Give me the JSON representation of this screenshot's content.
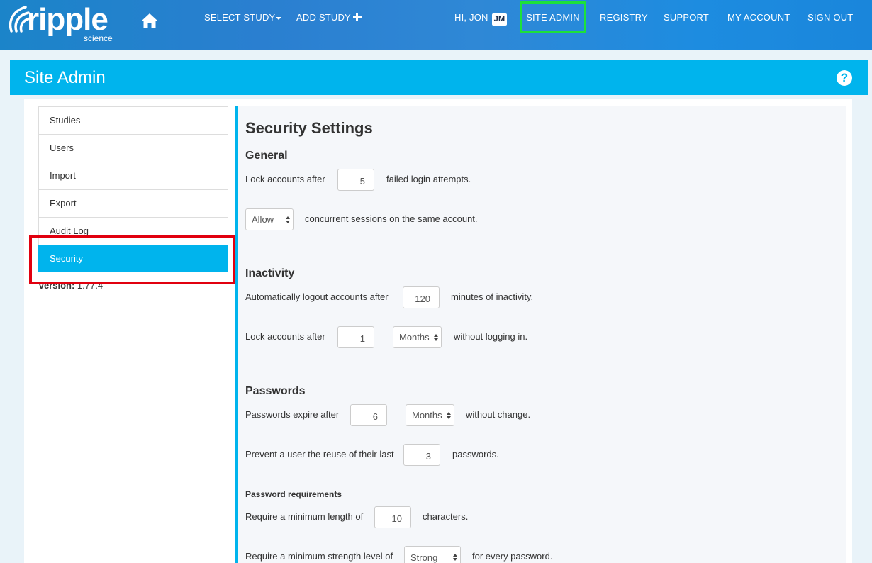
{
  "brand": {
    "logo_text": "ripple",
    "logo_sub": "science",
    "logo_icon": "ripple-waves-icon"
  },
  "nav": {
    "home_icon": "home-icon",
    "select_study": "SELECT STUDY",
    "add_study": "ADD STUDY",
    "greeting": "HI, JON",
    "user_initials": "JM",
    "site_admin": "SITE ADMIN",
    "registry": "REGISTRY",
    "support": "SUPPORT",
    "my_account": "MY ACCOUNT",
    "sign_out": "SIGN OUT"
  },
  "header": {
    "title": "Site Admin",
    "help_icon": "question-circle-icon",
    "help_glyph": "?"
  },
  "sidebar": {
    "items": [
      {
        "label": "Studies"
      },
      {
        "label": "Users"
      },
      {
        "label": "Import"
      },
      {
        "label": "Export"
      },
      {
        "label": "Audit Log"
      },
      {
        "label": "Security",
        "active": true
      }
    ],
    "version_label": "Version:",
    "version_value": "1.77.4"
  },
  "settings": {
    "title": "Security Settings",
    "general": {
      "title": "General",
      "lock_prefix": "Lock accounts after",
      "lock_value": "5",
      "lock_suffix": "failed login attempts.",
      "sessions_value": "Allow",
      "sessions_suffix": "concurrent sessions on the same account."
    },
    "inactivity": {
      "title": "Inactivity",
      "logout_prefix": "Automatically logout accounts after",
      "logout_value": "120",
      "logout_suffix": "minutes of inactivity.",
      "lock_prefix": "Lock accounts after",
      "lock_value": "1",
      "lock_unit": "Months",
      "lock_suffix": "without logging in."
    },
    "passwords": {
      "title": "Passwords",
      "expire_prefix": "Passwords expire after",
      "expire_value": "6",
      "expire_unit": "Months",
      "expire_suffix": "without change.",
      "reuse_prefix": "Prevent a user the reuse of their last",
      "reuse_value": "3",
      "reuse_suffix": "passwords.",
      "requirements_title": "Password requirements",
      "min_length_prefix": "Require a minimum length of",
      "min_length_value": "10",
      "min_length_suffix": "characters.",
      "strength_prefix": "Require a minimum strength level of",
      "strength_value": "Strong",
      "strength_suffix": "for every password."
    }
  },
  "colors": {
    "accent": "#00b4ed",
    "nav_highlight": "#1de13a",
    "annotation_red": "#e1000f"
  }
}
